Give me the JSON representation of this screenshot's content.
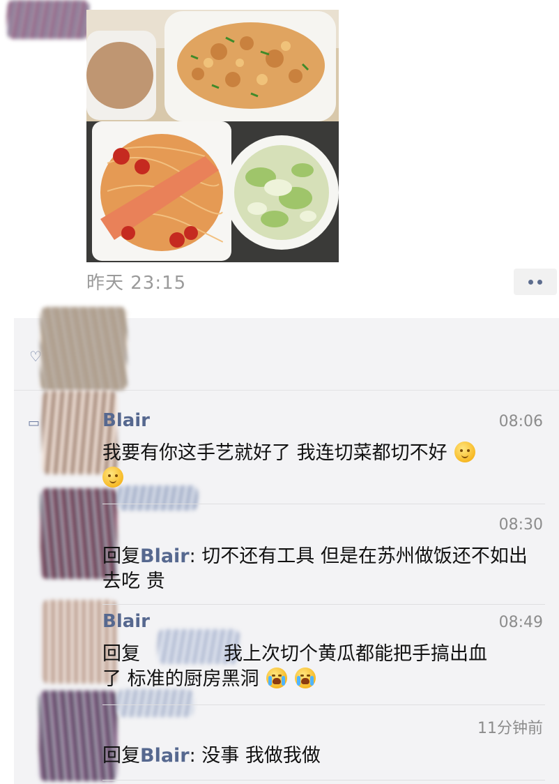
{
  "post": {
    "timestamp": "昨天 23:15",
    "more_icon": "ellipsis-dots-icon"
  },
  "comments": [
    {
      "name": "Blair",
      "time": "08:06",
      "text": "我要有你这手艺就好了 我连切菜都切不好",
      "emoji_count": 2
    },
    {
      "name": "",
      "time": "08:30",
      "reply_prefix": "回复",
      "reply_to": "Blair",
      "text": ": 切不还有工具 但是在苏州做饭还不如出去吃 贵"
    },
    {
      "name": "Blair",
      "time": "08:49",
      "reply_prefix": "回复",
      "text_line1": "我上次切个黄瓜都能把手搞出血",
      "text_line2": "了 标准的厨房黑洞"
    },
    {
      "name": "",
      "time": "11分钟前",
      "reply_prefix": "回复",
      "reply_to": "Blair",
      "text": ": 没事 我做我做"
    }
  ],
  "colors": {
    "name_blue": "#56688f",
    "panel_bg": "#f3f3f5",
    "time_gray": "#8c8c8c"
  }
}
